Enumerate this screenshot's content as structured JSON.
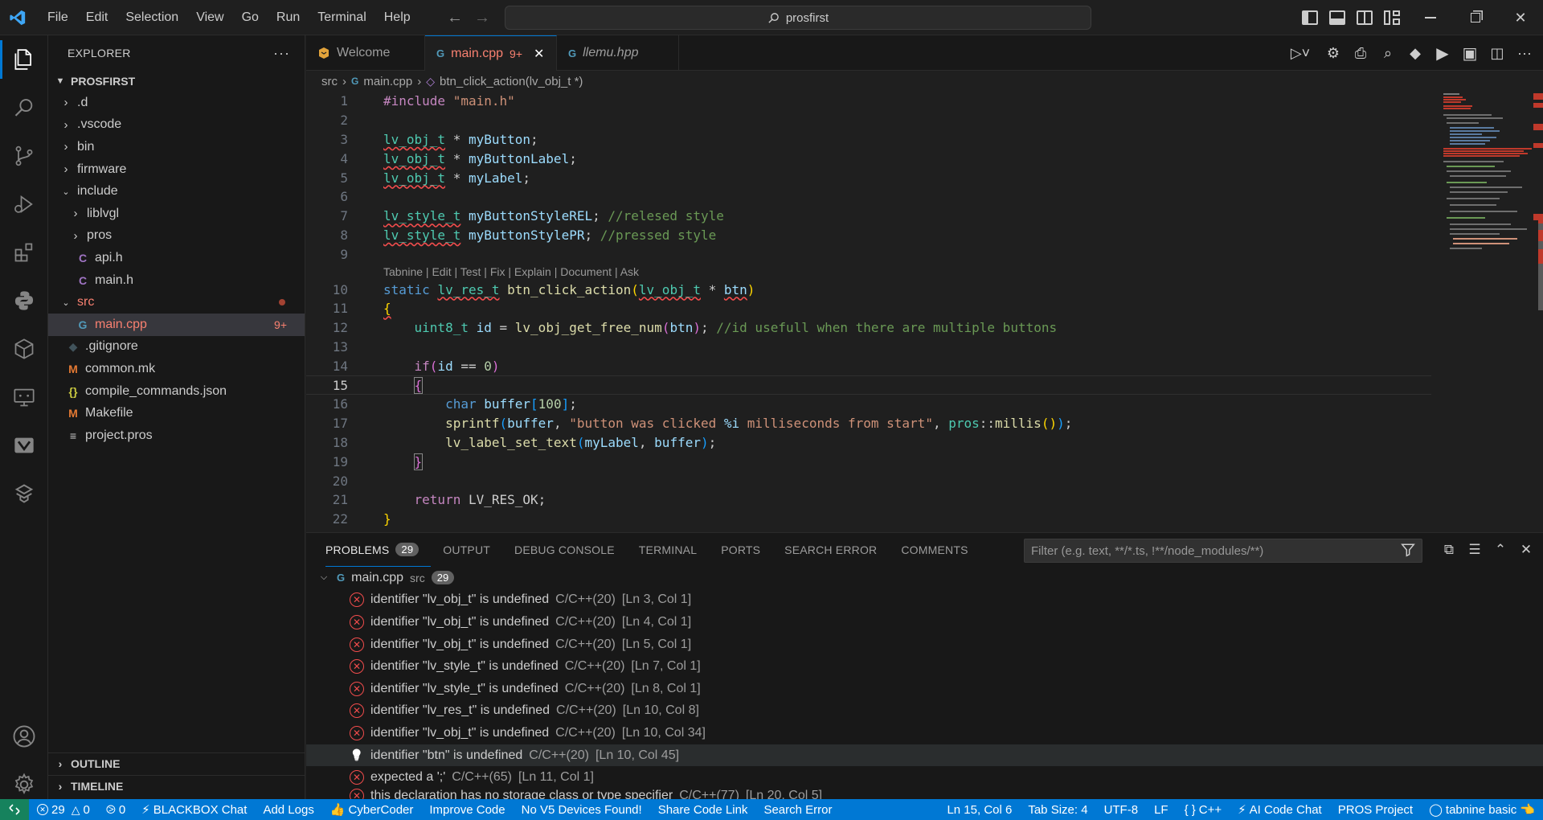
{
  "menu": [
    "File",
    "Edit",
    "Selection",
    "View",
    "Go",
    "Run",
    "Terminal",
    "Help"
  ],
  "search": {
    "text": "prosfirst"
  },
  "activity": [
    "files-icon",
    "search-icon",
    "source-control-icon",
    "run-debug-icon",
    "extensions-icon",
    "python-icon",
    "cube-icon",
    "remote-explorer-icon",
    "vbox-icon",
    "tabnine-icon"
  ],
  "sidebar": {
    "title": "EXPLORER",
    "more": "···",
    "project": "PROSFIRST",
    "items": [
      {
        "label": ".d",
        "type": "folder",
        "indent": 1,
        "expanded": false
      },
      {
        "label": ".vscode",
        "type": "folder",
        "indent": 1,
        "expanded": false
      },
      {
        "label": "bin",
        "type": "folder",
        "indent": 1,
        "expanded": false
      },
      {
        "label": "firmware",
        "type": "folder",
        "indent": 1,
        "expanded": false
      },
      {
        "label": "include",
        "type": "folder",
        "indent": 1,
        "expanded": true
      },
      {
        "label": "liblvgl",
        "type": "folder",
        "indent": 2,
        "expanded": false
      },
      {
        "label": "pros",
        "type": "folder",
        "indent": 2,
        "expanded": false
      },
      {
        "label": "api.h",
        "type": "c",
        "indent": 2
      },
      {
        "label": "main.h",
        "type": "c",
        "indent": 2
      },
      {
        "label": "src",
        "type": "folder",
        "indent": 1,
        "expanded": true,
        "error": true
      },
      {
        "label": "main.cpp",
        "type": "cpp",
        "indent": 2,
        "error": true,
        "badge": "9+",
        "selected": true
      },
      {
        "label": ".gitignore",
        "type": "git",
        "indent": 1
      },
      {
        "label": "common.mk",
        "type": "mk",
        "indent": 1
      },
      {
        "label": "compile_commands.json",
        "type": "json",
        "indent": 1
      },
      {
        "label": "Makefile",
        "type": "mk",
        "indent": 1
      },
      {
        "label": "project.pros",
        "type": "text",
        "indent": 1
      }
    ],
    "outline": "OUTLINE",
    "timeline": "TIMELINE"
  },
  "tabs": [
    {
      "label": "Welcome",
      "icon": "vscode-welcome-icon"
    },
    {
      "label": "main.cpp",
      "badge": "9+",
      "active": true,
      "icon": "cpp-icon"
    },
    {
      "label": "llemu.hpp",
      "italic": true,
      "icon": "cpp-icon"
    }
  ],
  "breadcrumb": {
    "folder": "src",
    "file": "main.cpp",
    "symbol": "btn_click_action(lv_obj_t *)"
  },
  "codelens": "Tabnine | Edit | Test | Fix | Explain | Document | Ask",
  "line_numbers": [
    "1",
    "2",
    "3",
    "4",
    "5",
    "6",
    "7",
    "8",
    "9",
    "10",
    "11",
    "12",
    "13",
    "14",
    "15",
    "16",
    "17",
    "18",
    "19",
    "20",
    "21",
    "22"
  ],
  "current_line": "15",
  "panel": {
    "tabs": [
      {
        "label": "PROBLEMS",
        "count": "29",
        "active": true
      },
      {
        "label": "OUTPUT"
      },
      {
        "label": "DEBUG CONSOLE"
      },
      {
        "label": "TERMINAL"
      },
      {
        "label": "PORTS"
      },
      {
        "label": "SEARCH ERROR"
      },
      {
        "label": "COMMENTS"
      }
    ],
    "filter_placeholder": "Filter (e.g. text, **/*.ts, !**/node_modules/**)",
    "group": {
      "file": "main.cpp",
      "folder": "src",
      "count": "29"
    },
    "problems": [
      {
        "msg": "identifier \"lv_obj_t\" is undefined",
        "src": "C/C++(20)",
        "loc": "[Ln 3, Col 1]"
      },
      {
        "msg": "identifier \"lv_obj_t\" is undefined",
        "src": "C/C++(20)",
        "loc": "[Ln 4, Col 1]"
      },
      {
        "msg": "identifier \"lv_obj_t\" is undefined",
        "src": "C/C++(20)",
        "loc": "[Ln 5, Col 1]"
      },
      {
        "msg": "identifier \"lv_style_t\" is undefined",
        "src": "C/C++(20)",
        "loc": "[Ln 7, Col 1]"
      },
      {
        "msg": "identifier \"lv_style_t\" is undefined",
        "src": "C/C++(20)",
        "loc": "[Ln 8, Col 1]"
      },
      {
        "msg": "identifier \"lv_res_t\" is undefined",
        "src": "C/C++(20)",
        "loc": "[Ln 10, Col 8]"
      },
      {
        "msg": "identifier \"lv_obj_t\" is undefined",
        "src": "C/C++(20)",
        "loc": "[Ln 10, Col 34]"
      },
      {
        "msg": "identifier \"btn\" is undefined",
        "src": "C/C++(20)",
        "loc": "[Ln 10, Col 45]",
        "highlight": true
      },
      {
        "msg": "expected a ';'",
        "src": "C/C++(65)",
        "loc": "[Ln 11, Col 1]"
      },
      {
        "msg": "this declaration has no storage class or type specifier",
        "src": "C/C++(77)",
        "loc": "[Ln 20, Col 5]"
      }
    ]
  },
  "status": {
    "errors": "29",
    "warnings": "0",
    "ports": "0",
    "left": [
      "BLACKBOX Chat",
      "Add Logs",
      "CyberCoder",
      "Improve Code",
      "No V5 Devices Found!",
      "Share Code Link",
      "Search Error"
    ],
    "position": "Ln 15, Col 6",
    "tabsize": "Tab Size: 4",
    "encoding": "UTF-8",
    "eol": "LF",
    "language": "C++",
    "ai_chat": "AI Code Chat",
    "pros": "PROS Project",
    "tabnine": "tabnine basic"
  }
}
